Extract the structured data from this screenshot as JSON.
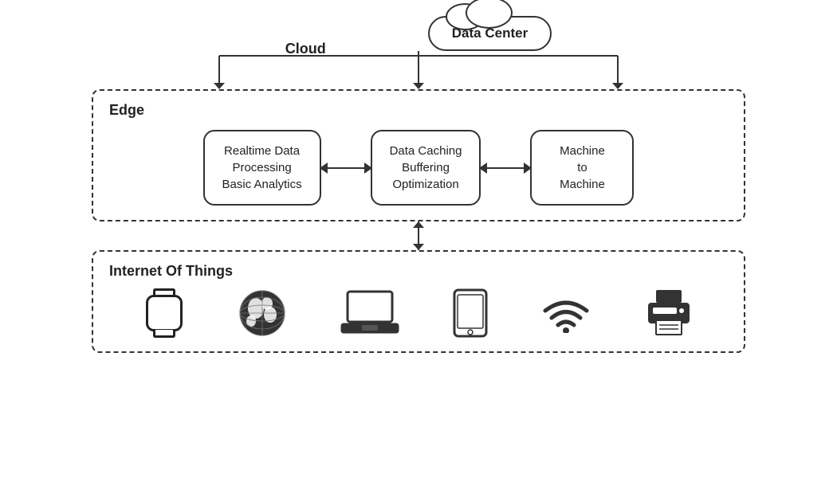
{
  "cloud": {
    "label": "Cloud",
    "box_label": "Data Center"
  },
  "edge": {
    "label": "Edge",
    "nodes": [
      {
        "id": "realtime",
        "line1": "Realtime Data",
        "line2": "Processing",
        "line3": "Basic Analytics"
      },
      {
        "id": "caching",
        "line1": "Data Caching",
        "line2": "Buffering",
        "line3": "Optimization"
      },
      {
        "id": "m2m",
        "line1": "Machine",
        "line2": "to",
        "line3": "Machine"
      }
    ]
  },
  "iot": {
    "label": "Internet Of Things",
    "icons": [
      {
        "id": "smartwatch",
        "name": "Smartwatch"
      },
      {
        "id": "globe",
        "name": "Globe/World"
      },
      {
        "id": "laptop",
        "name": "Laptop"
      },
      {
        "id": "tablet",
        "name": "Tablet"
      },
      {
        "id": "wifi",
        "name": "WiFi"
      },
      {
        "id": "printer",
        "name": "Printer"
      }
    ]
  }
}
